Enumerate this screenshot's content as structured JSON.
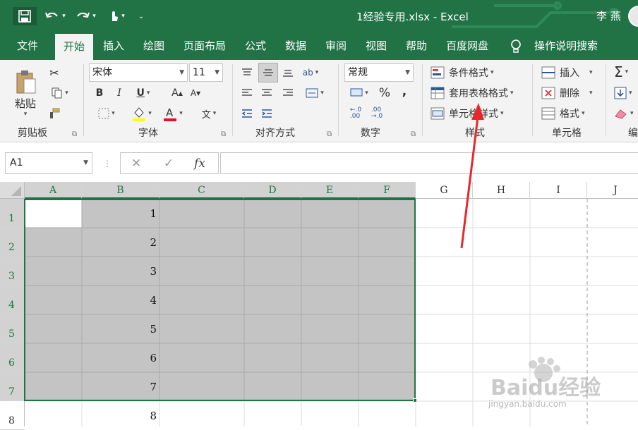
{
  "titlebar": {
    "title": "1经验专用.xlsx  -  Excel",
    "user": "李 燕",
    "save_icon": "save-icon",
    "undo_icon": "undo-icon",
    "redo_icon": "redo-icon",
    "touch_icon": "touch-mode-icon",
    "brand_color": "#217346"
  },
  "tabs": [
    "文件",
    "开始",
    "插入",
    "绘图",
    "页面布局",
    "公式",
    "数据",
    "审阅",
    "视图",
    "帮助",
    "百度网盘"
  ],
  "active_tab": "开始",
  "tell_me": "操作说明搜索",
  "ribbon": {
    "clipboard": {
      "paste": "粘贴",
      "label": "剪贴板"
    },
    "font": {
      "name": "宋体",
      "size": "11",
      "bold": "B",
      "italic": "I",
      "underline": "U",
      "grow": "A",
      "shrink": "A",
      "label": "字体",
      "wen": "文"
    },
    "align": {
      "label": "对齐方式"
    },
    "number": {
      "format": "常规",
      "percent": "%",
      "comma": ",",
      "label": "数字"
    },
    "styles": {
      "cond": "条件格式",
      "table": "套用表格格式",
      "cell": "单元格样式",
      "label": "样式"
    },
    "cells": {
      "insert": "插入",
      "delete": "删除",
      "format": "格式",
      "label": "单元格"
    },
    "editing": {
      "sum": "Σ",
      "label": "编"
    }
  },
  "formula_bar": {
    "name_box": "A1",
    "cancel": "✕",
    "enter": "✓",
    "fx": "fx",
    "value": ""
  },
  "sheet": {
    "columns": [
      "A",
      "B",
      "C",
      "D",
      "E",
      "F",
      "G",
      "H",
      "I",
      "J"
    ],
    "rows": [
      "1",
      "2",
      "3",
      "4",
      "5",
      "6",
      "7",
      "8"
    ],
    "b_values": [
      "1",
      "2",
      "3",
      "4",
      "5",
      "6",
      "7",
      "8"
    ],
    "selection": "A1:F7"
  },
  "watermark": {
    "brand": "Baidu经验",
    "url": "jingyan.baidu.com"
  }
}
